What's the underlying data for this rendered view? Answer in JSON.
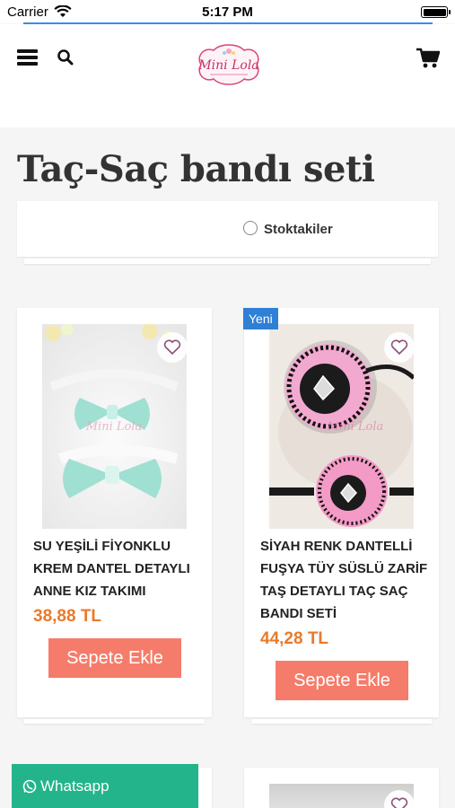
{
  "status_bar": {
    "carrier": "Carrier",
    "time": "5:17 PM"
  },
  "header": {
    "menu_icon": "hamburger-icon",
    "search_icon": "search-icon",
    "logo_text": "Mini Lola",
    "cart_icon": "cart-icon"
  },
  "page": {
    "title": "Taç-Saç bandı seti"
  },
  "filter": {
    "stock_label": "Stoktakiler",
    "stock_checked": false
  },
  "products": [
    {
      "name": "SU YEŞİLİ FİYONKLU KREM DANTEL DETAYLI ANNE KIZ TAKIMI",
      "price": "38,88 TL",
      "button": "Sepete Ekle",
      "badge": ""
    },
    {
      "name": "SİYAH RENK DANTELLİ FUŞYA TÜY SÜSLÜ ZARİF TAŞ DETAYLI TAÇ SAÇ BANDI SETİ",
      "price": "44,28 TL",
      "button": "Sepete Ekle",
      "badge": "Yeni"
    }
  ],
  "whatsapp": {
    "label": "Whatsapp"
  },
  "colors": {
    "accent_button": "#f57c6a",
    "price": "#ea7a2a",
    "whatsapp": "#23b48b",
    "badge": "#2e7fd6"
  }
}
